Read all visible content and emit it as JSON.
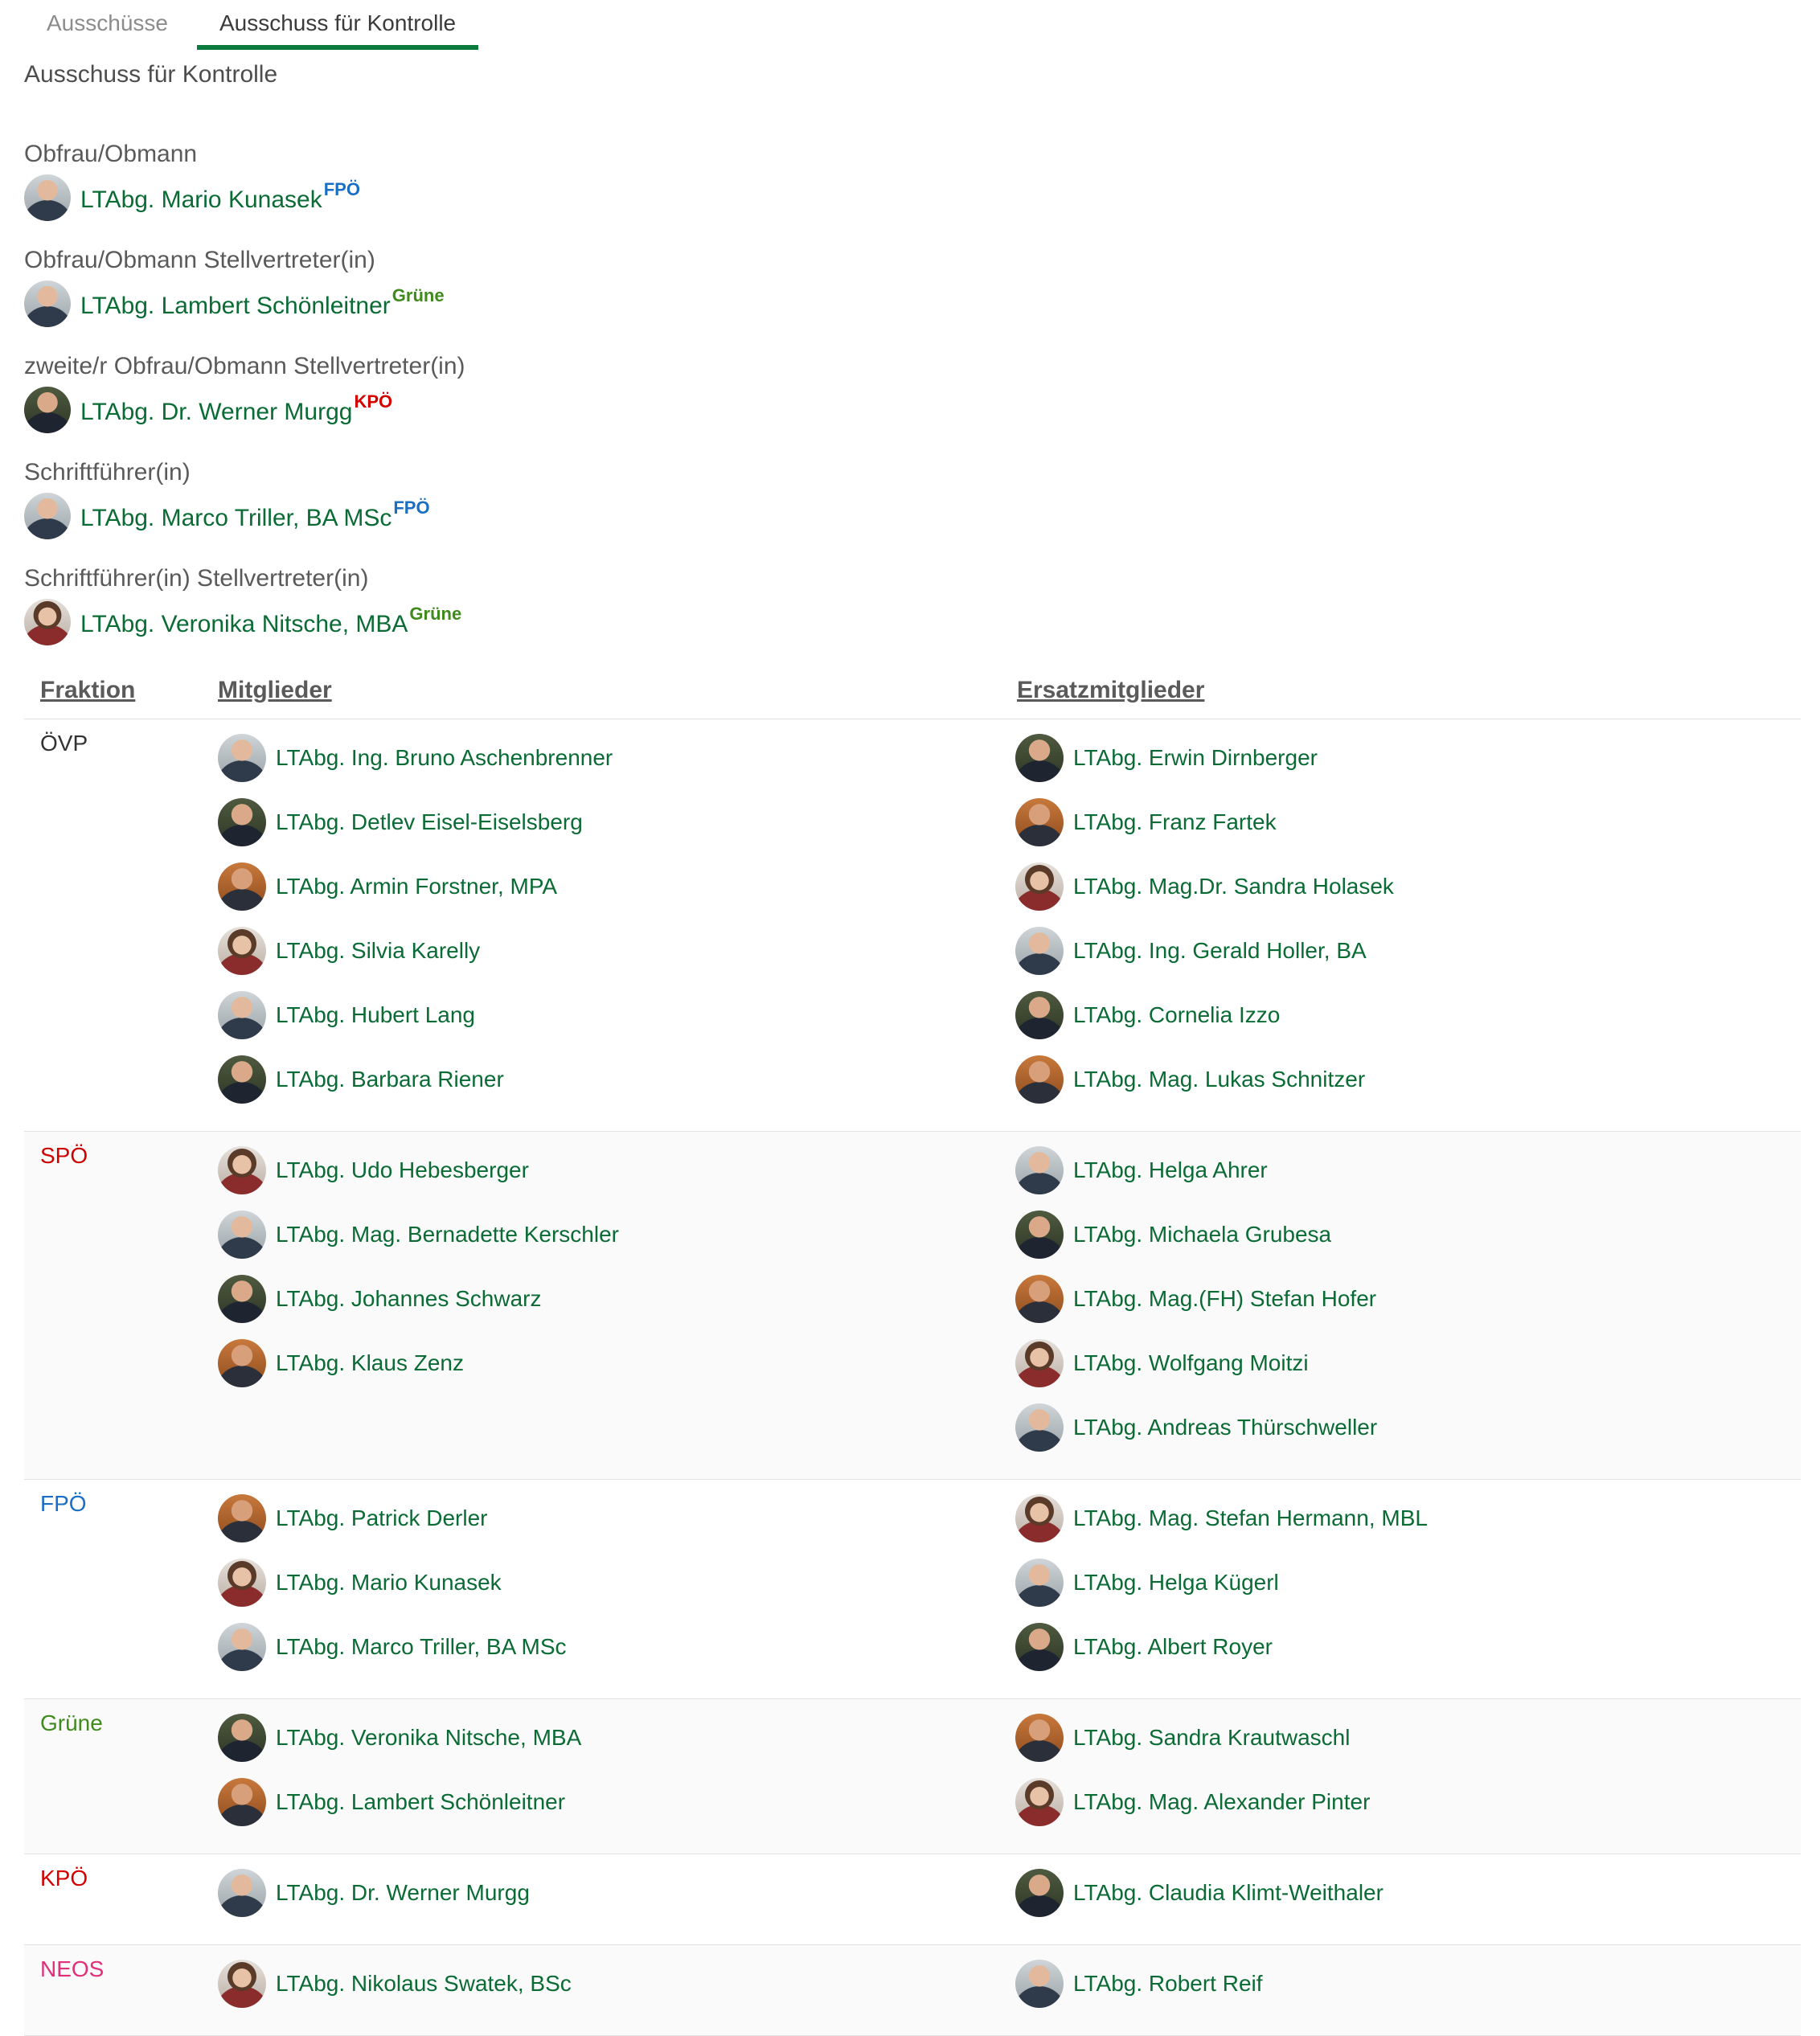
{
  "tabs": [
    {
      "label": "Ausschüsse",
      "active": false
    },
    {
      "label": "Ausschuss für Kontrolle",
      "active": true
    }
  ],
  "page_title": "Ausschuss für Kontrolle",
  "colors": {
    "accent": "#0b7a3c",
    "link": "#0b6b35",
    "parties": {
      "ÖVP": "#333333",
      "SPÖ": "#cc0000",
      "FPÖ": "#1a6fc4",
      "Grüne": "#3f8a1c",
      "KPÖ": "#d40000",
      "NEOS": "#e0307a"
    }
  },
  "officers": [
    {
      "role": "Obfrau/Obmann",
      "name": "LTAbg. Mario Kunasek",
      "party": "FPÖ"
    },
    {
      "role": "Obfrau/Obmann Stellvertreter(in)",
      "name": "LTAbg. Lambert Schönleitner",
      "party": "Grüne"
    },
    {
      "role": "zweite/r Obfrau/Obmann Stellvertreter(in)",
      "name": "LTAbg. Dr. Werner Murgg",
      "party": "KPÖ"
    },
    {
      "role": "Schriftführer(in)",
      "name": "LTAbg. Marco Triller, BA MSc",
      "party": "FPÖ"
    },
    {
      "role": "Schriftführer(in) Stellvertreter(in)",
      "name": "LTAbg. Veronika Nitsche, MBA",
      "party": "Grüne"
    }
  ],
  "table": {
    "headers": {
      "fraktion": "Fraktion",
      "mitglieder": "Mitglieder",
      "ersatz": "Ersatzmitglieder"
    },
    "groups": [
      {
        "party": "ÖVP",
        "members": [
          "LTAbg. Ing. Bruno Aschenbrenner",
          "LTAbg. Detlev Eisel-Eiselsberg",
          "LTAbg. Armin Forstner, MPA",
          "LTAbg. Silvia Karelly",
          "LTAbg. Hubert Lang",
          "LTAbg. Barbara Riener"
        ],
        "substitutes": [
          "LTAbg. Erwin Dirnberger",
          "LTAbg. Franz Fartek",
          "LTAbg. Mag.Dr. Sandra Holasek",
          "LTAbg. Ing. Gerald Holler, BA",
          "LTAbg. Cornelia Izzo",
          "LTAbg. Mag. Lukas Schnitzer"
        ]
      },
      {
        "party": "SPÖ",
        "members": [
          "LTAbg. Udo Hebesberger",
          "LTAbg. Mag. Bernadette Kerschler",
          "LTAbg. Johannes Schwarz",
          "LTAbg. Klaus Zenz"
        ],
        "substitutes": [
          "LTAbg. Helga Ahrer",
          "LTAbg. Michaela Grubesa",
          "LTAbg. Mag.(FH) Stefan Hofer",
          "LTAbg. Wolfgang Moitzi",
          "LTAbg. Andreas Thürschweller"
        ]
      },
      {
        "party": "FPÖ",
        "members": [
          "LTAbg. Patrick Derler",
          "LTAbg. Mario Kunasek",
          "LTAbg. Marco Triller, BA MSc"
        ],
        "substitutes": [
          "LTAbg. Mag. Stefan Hermann, MBL",
          "LTAbg. Helga Kügerl",
          "LTAbg. Albert Royer"
        ]
      },
      {
        "party": "Grüne",
        "members": [
          "LTAbg. Veronika Nitsche, MBA",
          "LTAbg. Lambert Schönleitner"
        ],
        "substitutes": [
          "LTAbg. Sandra Krautwaschl",
          "LTAbg. Mag. Alexander Pinter"
        ]
      },
      {
        "party": "KPÖ",
        "members": [
          "LTAbg. Dr. Werner Murgg"
        ],
        "substitutes": [
          "LTAbg. Claudia Klimt-Weithaler"
        ]
      },
      {
        "party": "NEOS",
        "members": [
          "LTAbg. Nikolaus Swatek, BSc"
        ],
        "substitutes": [
          "LTAbg. Robert Reif"
        ]
      }
    ]
  }
}
